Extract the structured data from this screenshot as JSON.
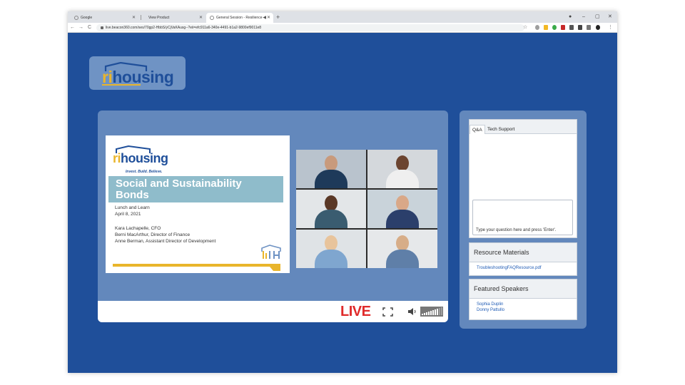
{
  "browser": {
    "tabs": [
      {
        "label": "Google"
      },
      {
        "label": "View Product"
      },
      {
        "label": "General Session - Resilience"
      }
    ],
    "new_tab": "+",
    "window_controls": {
      "minimize": "–",
      "maximize": "▢",
      "close": "✕"
    },
    "url": "live.beacon360.com/ses/70gp2-HbbS/yCjVaKAusg--?eii=efc911a6-340e-4491-b1a2-9800ef9011e8",
    "nav": {
      "back": "←",
      "forward": "→",
      "reload": "C"
    },
    "menu": "⋮"
  },
  "header": {
    "logo": {
      "ri": "ri",
      "housing": "housing"
    }
  },
  "player": {
    "slide": {
      "logo": {
        "ri": "ri",
        "housing": "housing"
      },
      "tagline": "Invest. Build. Believe.",
      "title": "Social and Sustainability Bonds",
      "event": "Lunch and Learn",
      "date": "April 8, 2021",
      "speakers": [
        "Kara Lachapelle, CFO",
        "Berni MacArthur, Director of Finance",
        "Anne Berman, Assistant Director of Development"
      ]
    },
    "live_label": "LIVE",
    "volume_level": 0.8
  },
  "qa": {
    "tabs": [
      "Q&A",
      "Tech Support"
    ],
    "placeholder": "Type your question here and press 'Enter'."
  },
  "resources": {
    "title": "Resource Materials",
    "files": [
      "TroubleshootingFAQResource.pdf"
    ]
  },
  "speakers_panel": {
    "title": "Featured Speakers",
    "names": [
      "Sophia Duplin",
      "Donny Pattullo"
    ]
  },
  "colors": {
    "page_background": "#1f4f9a",
    "panel_background": "#6388bc",
    "brand_gold": "#e9b52b",
    "brand_blue": "#1f4f9a",
    "live_red": "#e02b2b",
    "link_blue": "#1f5bb5"
  }
}
